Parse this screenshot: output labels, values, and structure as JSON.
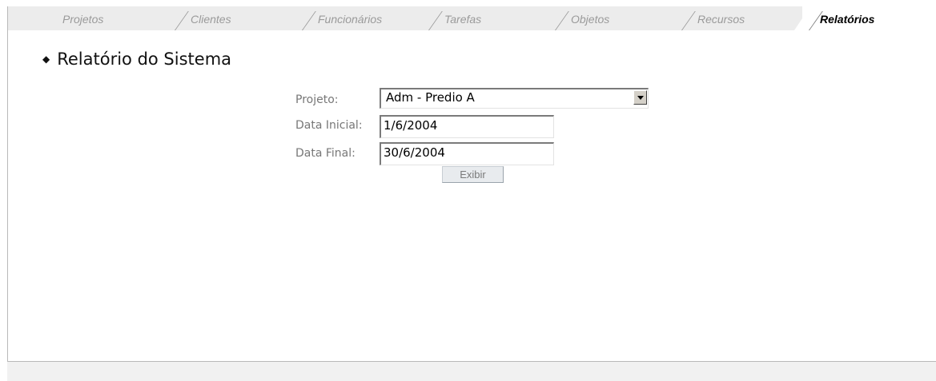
{
  "tabs": [
    {
      "label": "Projetos"
    },
    {
      "label": "Clientes"
    },
    {
      "label": "Funcionários"
    },
    {
      "label": "Tarefas"
    },
    {
      "label": "Objetos"
    },
    {
      "label": "Recursos"
    },
    {
      "label": "Relatórios",
      "active": true
    }
  ],
  "page": {
    "title": "Relatório do Sistema",
    "bullet": "◆"
  },
  "form": {
    "projeto_label": "Projeto:",
    "projeto_value": "Adm - Predio A",
    "data_inicial_label": "Data Inicial:",
    "data_inicial_value": "1/6/2004",
    "data_final_label": "Data Final:",
    "data_final_value": "30/6/2004",
    "submit_label": "Exibir"
  },
  "icons": {
    "select_arrow": "chevron-down-icon",
    "bullet": "diamond-bullet-icon"
  }
}
